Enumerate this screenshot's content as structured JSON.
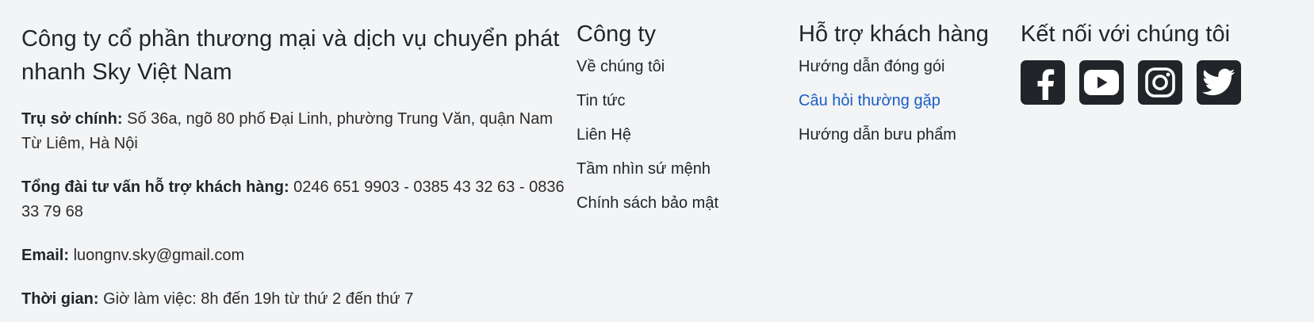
{
  "company_info": {
    "name": "Công ty cổ phần thương mại và dịch vụ chuyển phát nhanh Sky Việt Nam",
    "address_label": "Trụ sở chính:",
    "address_value": " Số 36a, ngõ 80 phố Đại Linh, phường Trung Văn, quận Nam Từ Liêm, Hà Nội",
    "hotline_label": "Tổng đài tư vấn hỗ trợ khách hàng:",
    "hotline_value": " 0246 651 9903 - 0385 43 32 63 - 0836 33 79 68",
    "email_label": "Email:",
    "email_value": " luongnv.sky@gmail.com",
    "hours_label": "Thời gian:",
    "hours_value": " Giờ làm việc: 8h đến 19h từ thứ 2 đến thứ 7"
  },
  "company": {
    "title": "Công ty",
    "links": [
      "Về chúng tôi",
      "Tin tức",
      "Liên Hệ",
      "Tầm nhìn sứ mệnh",
      "Chính sách bảo mật"
    ]
  },
  "support": {
    "title": "Hỗ trợ khách hàng",
    "links": [
      "Hướng dẫn đóng gói",
      "Câu hỏi thường gặp",
      "Hướng dẫn bưu phẩm"
    ],
    "active_color": "#1a5fc4"
  },
  "social": {
    "title": "Kết nối với chúng tôi",
    "icons": [
      "facebook-icon",
      "youtube-icon",
      "instagram-icon",
      "twitter-icon"
    ],
    "icon_bg": "#212529"
  }
}
